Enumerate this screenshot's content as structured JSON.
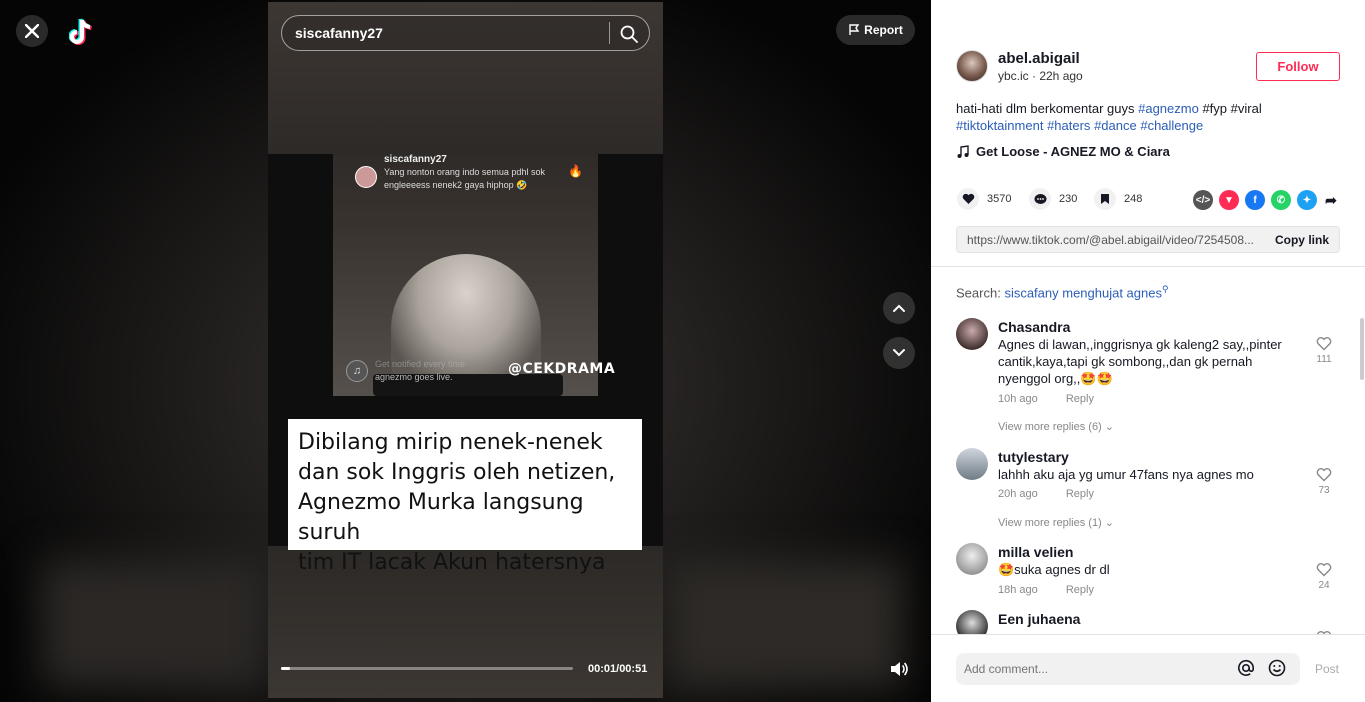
{
  "video": {
    "search_value": "siscafanny27",
    "report_label": "Report",
    "time": "00:01/00:51",
    "progress": 0.03,
    "caption_lines": [
      "Dibilang mirip nenek-nenek",
      "dan sok Inggris oleh netizen,",
      "Agnezmo Murka langsung suruh",
      "tim IT lacak Akun hatersnya"
    ],
    "clip": {
      "user": "siscafanny27",
      "message": "Yang nonton orang indo semua pdhl sok engleeeess nenek2 gaya hiphop 🤣",
      "notify_line1": "Get notified every time",
      "notify_line2": "agnezmo goes live.",
      "watermark": "@CEKDRAMA"
    }
  },
  "author": {
    "name": "abel.abigail",
    "meta": "ybc.ic · 22h ago",
    "follow_label": "Follow"
  },
  "description": {
    "text": "hati-hati dlm berkomentar guys",
    "tags": [
      "#agnezmo",
      "#fyp",
      "#viral",
      "#tiktoktainment",
      "#haters",
      "#dance",
      "#challenge"
    ]
  },
  "music": "Get Loose - AGNEZ MO & Ciara",
  "stats": {
    "likes": "3570",
    "comments": "230",
    "saves": "248"
  },
  "share_icons": [
    "embed-icon",
    "send-icon",
    "facebook-icon",
    "whatsapp-icon",
    "twitter-icon",
    "share-arrow-icon"
  ],
  "link": {
    "url": "https://www.tiktok.com/@abel.abigail/video/7254508...",
    "copy_label": "Copy link"
  },
  "search_suggestion": {
    "prefix": "Search:",
    "query": "siscafany menghujat agnes"
  },
  "comments": [
    {
      "name": "Chasandra",
      "text": "Agnes di lawan,,inggrisnya gk kaleng2 say,,pinter cantik,kaya,tapi gk sombong,,dan gk pernah nyenggol org,,🤩🤩",
      "time": "10h ago",
      "reply": "Reply",
      "likes": "111",
      "more": "View more replies (6)"
    },
    {
      "name": "tutylestary",
      "text": "lahhh aku aja yg umur 47fans nya agnes mo",
      "time": "20h ago",
      "reply": "Reply",
      "likes": "73",
      "more": "View more replies (1)"
    },
    {
      "name": "milla velien",
      "text": "🤩suka agnes dr dl",
      "time": "18h ago",
      "reply": "Reply",
      "likes": "24",
      "more": ""
    },
    {
      "name": "Een juhaena",
      "text": "",
      "time": "",
      "reply": "",
      "likes": "",
      "more": ""
    }
  ],
  "comment_bar": {
    "placeholder": "Add comment...",
    "post_label": "Post"
  },
  "colors": {
    "accent": "#fe2c55",
    "hashtag": "#2b5db9"
  }
}
